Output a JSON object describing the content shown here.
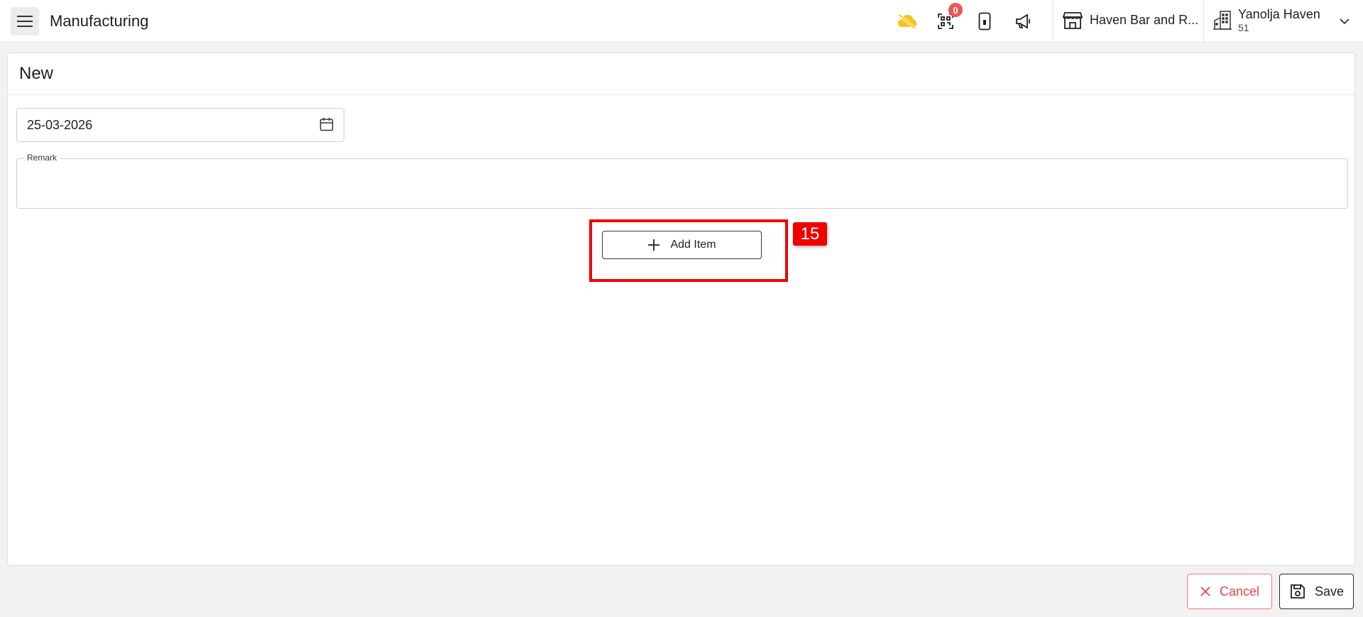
{
  "header": {
    "title": "Manufacturing",
    "notification_count": "0",
    "store_name": "Haven Bar and R...",
    "user_name": "Yanolja Haven",
    "user_sub": "51"
  },
  "form": {
    "title": "New",
    "date_value": "25-03-2026",
    "remark_label": "Remark",
    "remark_value": "",
    "add_item_label": "Add Item"
  },
  "annotation": {
    "marker_label": "15"
  },
  "footer": {
    "cancel_label": "Cancel",
    "save_label": "Save"
  },
  "icons": {
    "menu": "menu-icon",
    "cloud_off": "cloud-off-icon",
    "qr": "qr-code-icon",
    "phone": "mobile-phone-icon",
    "announce": "megaphone-icon",
    "store": "storefront-icon",
    "building": "building-icon",
    "chevron": "chevron-down-icon",
    "calendar": "calendar-icon",
    "plus": "plus-icon",
    "close": "close-icon",
    "save": "floppy-disk-icon"
  },
  "colors": {
    "accent_warning": "#f5c518",
    "badge": "#f05454",
    "highlight": "#f00000",
    "cancel": "#e84545"
  }
}
